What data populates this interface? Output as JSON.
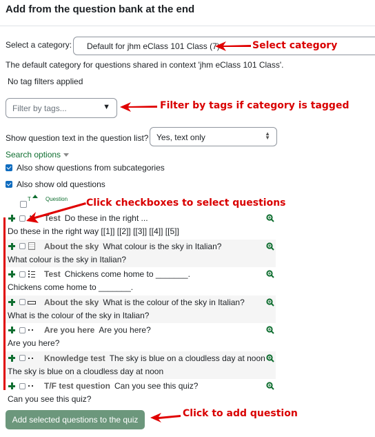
{
  "page": {
    "title": "Add from the question bank at the end"
  },
  "category": {
    "label": "Select a category:",
    "selected": "Default for jhm eClass 101 Class (7)",
    "description": "The default category for questions shared in context 'jhm eClass 101 Class'."
  },
  "tags": {
    "status": "No tag filters applied",
    "placeholder": "Filter by tags..."
  },
  "question_text": {
    "label": "Show question text in the question list?",
    "selected": "Yes, text only"
  },
  "search_options": {
    "label": "Search options",
    "checkboxes": [
      {
        "label": "Also show questions from subcategories",
        "checked": true
      },
      {
        "label": "Also show old questions",
        "checked": true
      }
    ]
  },
  "table_header": {
    "type_col": "T",
    "question_col": "Question"
  },
  "questions": [
    {
      "type_icon": "ordering-icon",
      "name": "Test",
      "title": "Do these in the right ...",
      "text": "Do these in the right way [[1]] [[2]] [[3]] [[4]] [[5]]"
    },
    {
      "type_icon": "calculated-icon",
      "name": "About the sky",
      "title": "What colour is the sky in Italian?",
      "text": "What colour is the sky in Italian?"
    },
    {
      "type_icon": "multichoice-icon",
      "name": "Test",
      "title": "Chickens come home to _______.",
      "text": "Chickens come home to _______."
    },
    {
      "type_icon": "shortanswer-icon",
      "name": "About the sky",
      "title": "What is the colour of the sky in Italian?",
      "text": "What is the colour of the sky in Italian?"
    },
    {
      "type_icon": "truefalse-icon",
      "name": "Are you here",
      "title": "Are you here?",
      "text": "Are you here?"
    },
    {
      "type_icon": "truefalse-icon",
      "name": "Knowledge test",
      "title": "The sky is blue on a cloudless day at noon",
      "text": "The sky is blue on a cloudless day at noon"
    },
    {
      "type_icon": "truefalse-icon",
      "name": "T/F test question",
      "title": "Can you see this quiz?",
      "text": "Can you see this quiz?"
    }
  ],
  "add_button": {
    "label": "Add selected questions to the quiz"
  },
  "annotations": {
    "select_category": "Select category",
    "filter_tags": "Filter by tags if category is tagged",
    "click_checkboxes": "Click checkboxes to select questions",
    "click_add": "Click to add question"
  },
  "colors": {
    "accent_green": "#0f6e30",
    "annotation_red": "#d90000",
    "button_bg": "#6c977c",
    "checkbox_blue": "#0f6cbf"
  }
}
